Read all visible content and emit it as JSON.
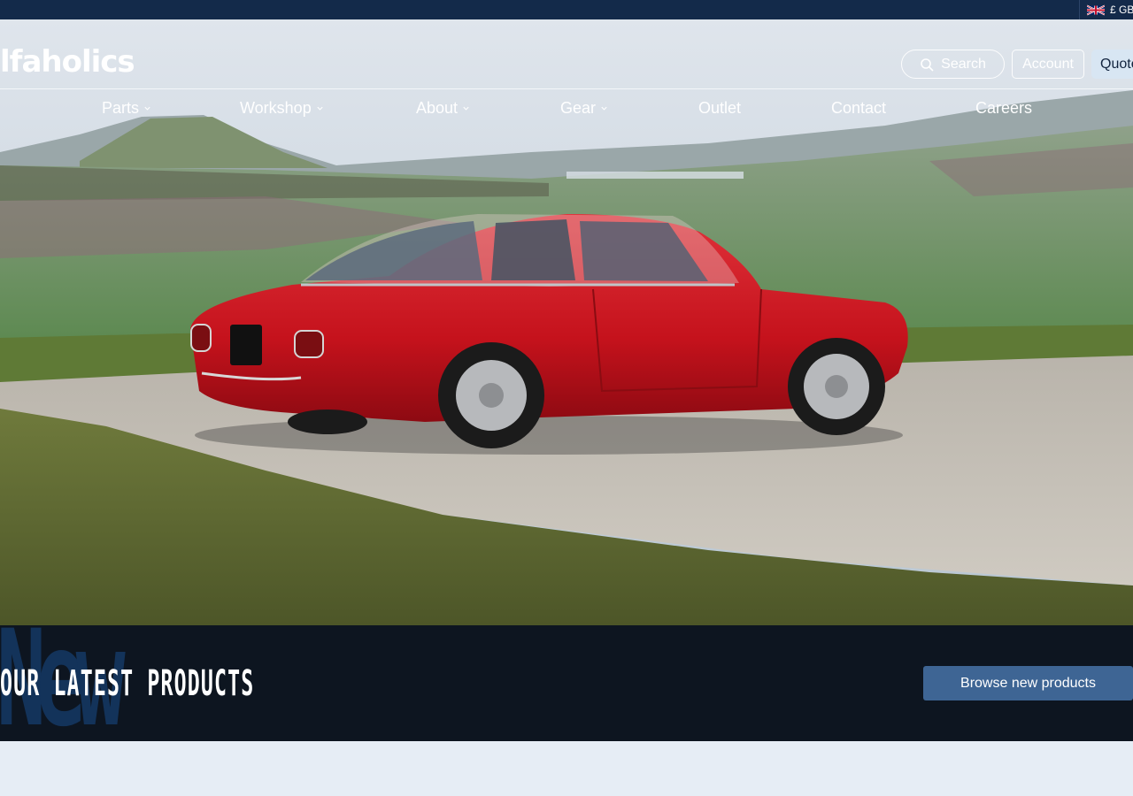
{
  "top_strip": {
    "currency_label": "£ GBP",
    "flag_icon": "uk-flag-icon"
  },
  "header": {
    "logo_text": "lfaholics",
    "search_label": "Search",
    "account_label": "Account",
    "quote_label": "Quote"
  },
  "nav": [
    {
      "label": "Parts",
      "has_dropdown": true
    },
    {
      "label": "Workshop",
      "has_dropdown": true
    },
    {
      "label": "About",
      "has_dropdown": true
    },
    {
      "label": "Gear",
      "has_dropdown": true
    },
    {
      "label": "Outlet",
      "has_dropdown": false
    },
    {
      "label": "Contact",
      "has_dropdown": false
    },
    {
      "label": "Careers",
      "has_dropdown": false
    }
  ],
  "band": {
    "bg_word": "New",
    "title": "OUR LATEST PRODUCTS",
    "browse_label": "Browse new products"
  },
  "colors": {
    "navy": "#132a4a",
    "band_dark": "#0d1520",
    "button_blue": "#3e6594",
    "car_red": "#c8141e"
  }
}
